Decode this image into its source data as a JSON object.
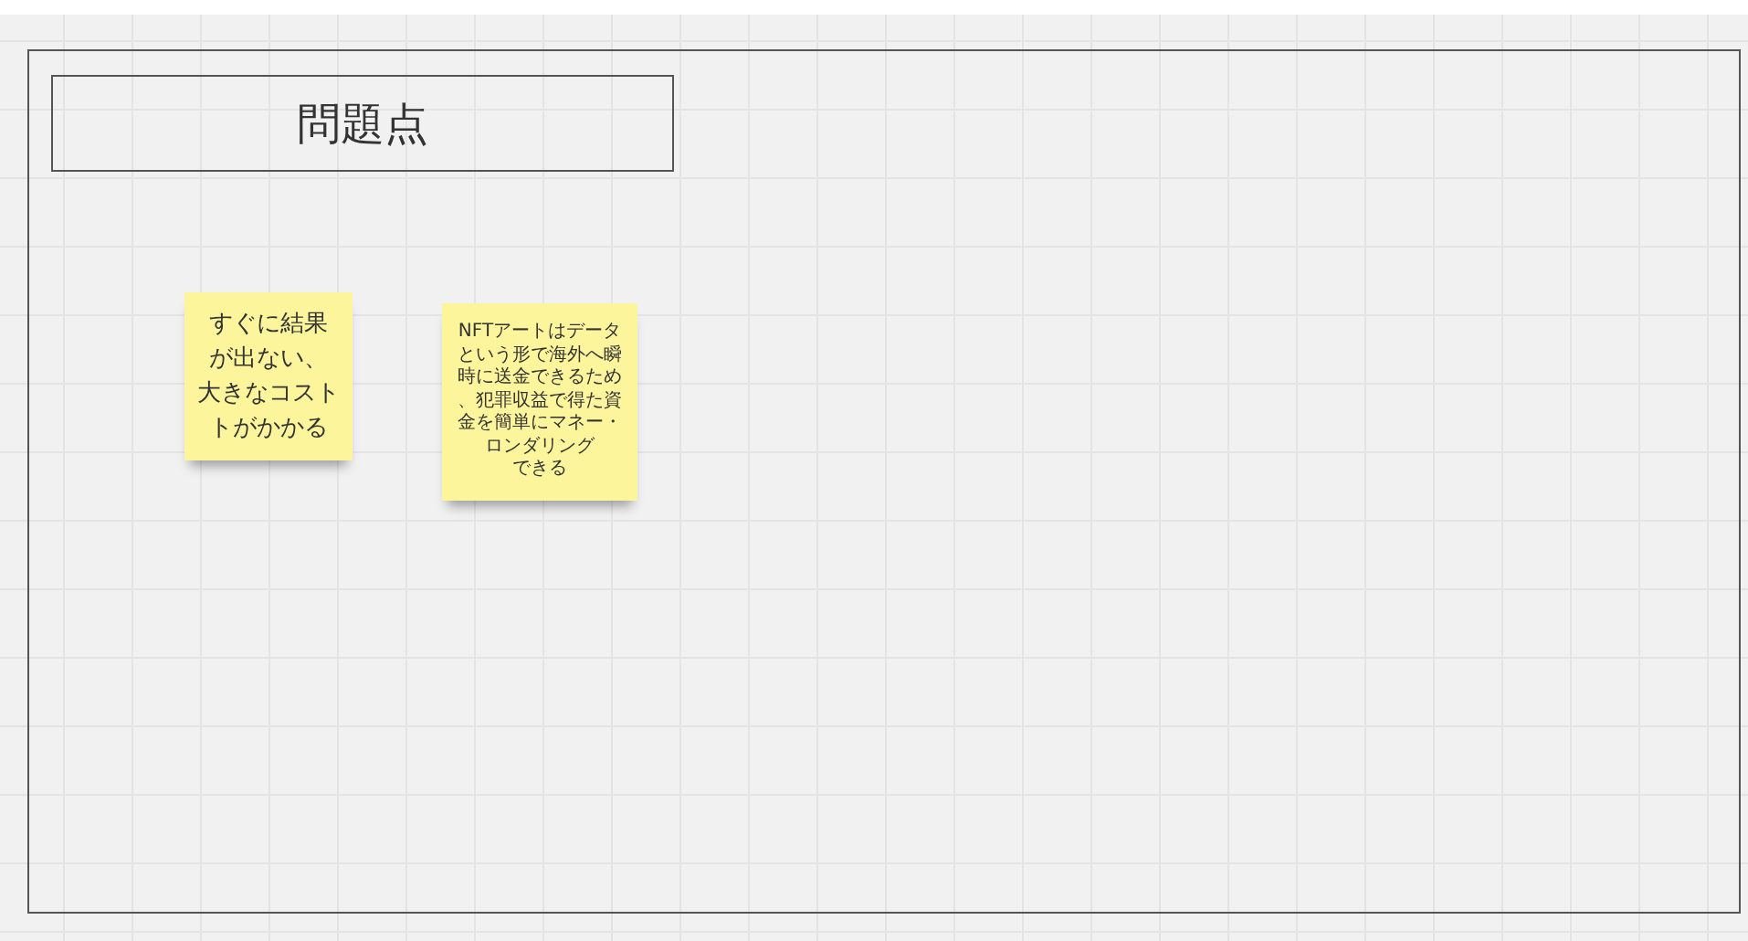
{
  "frame": {
    "title": "問題点"
  },
  "sticky_notes": [
    {
      "kind": "large",
      "lines": [
        "すぐに結果",
        "が出ない、",
        "大きなコスト",
        "トがかかる"
      ]
    },
    {
      "kind": "small",
      "lines": [
        "NFTアートはデータ",
        "という形で海外へ瞬",
        "時に送金できるため",
        "、犯罪収益で得た資",
        "金を簡単にマネー・",
        "ロンダリング",
        "できる"
      ]
    }
  ]
}
